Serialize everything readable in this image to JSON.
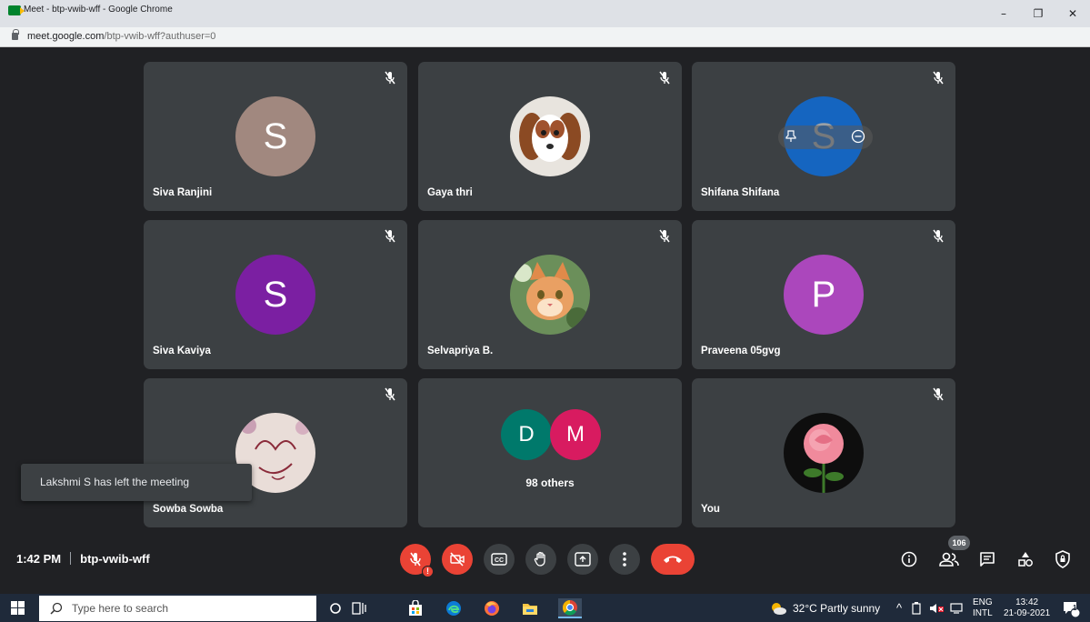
{
  "window": {
    "title": "Meet - btp-vwib-wff - Google Chrome",
    "controls": {
      "minimize": "–",
      "restore": "❐",
      "close": "✕"
    }
  },
  "address_bar": {
    "host": "meet.google.com",
    "path": "/btp-vwib-wff?authuser=0"
  },
  "tiles": [
    {
      "name": "Siva Ranjini",
      "initial": "S",
      "color": "#a1887f"
    },
    {
      "name": "Gaya thri",
      "photo": "puppy"
    },
    {
      "name": "Shifana Shifana",
      "initial": "S",
      "color": "#1565c0"
    },
    {
      "name": "Siva Kaviya",
      "initial": "S",
      "color": "#7b1fa2"
    },
    {
      "name": "Selvapriya B.",
      "photo": "kitten"
    },
    {
      "name": "Praveena 05gvg",
      "initial": "P",
      "color": "#ab47bc"
    },
    {
      "name": "Sowba Sowba",
      "photo": "sketch"
    },
    {
      "others_label": "98 others",
      "initials": [
        "D",
        "M"
      ],
      "colors": [
        "#00796b",
        "#d81b60"
      ]
    },
    {
      "name": "You",
      "photo": "rose"
    }
  ],
  "toast": "Lakshmi S has left the meeting",
  "meeting": {
    "time": "1:42 PM",
    "code": "btp-vwib-wff"
  },
  "people_count": "106",
  "taskbar": {
    "search_placeholder": "Type here to search",
    "weather": "32°C  Partly sunny",
    "lang_top": "ENG",
    "lang_bottom": "INTL",
    "clock_time": "13:42",
    "clock_date": "21-09-2021",
    "notification_count": "1"
  }
}
